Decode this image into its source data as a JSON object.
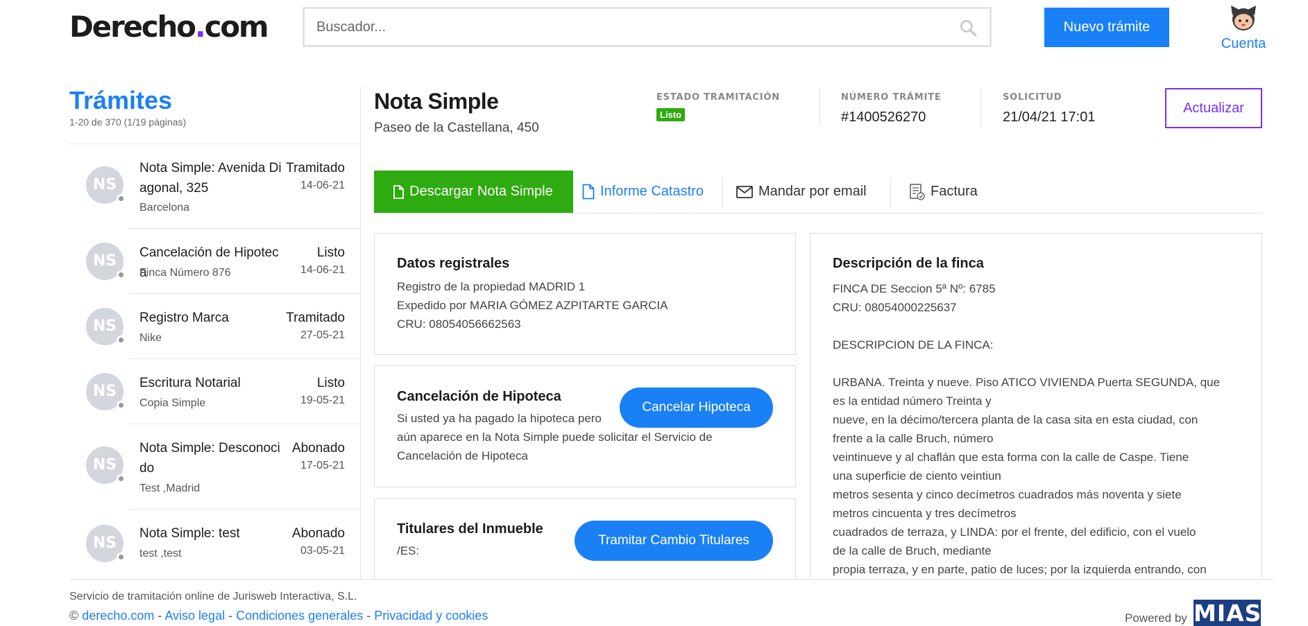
{
  "header": {
    "logo_main": "Derecho",
    "logo_dot": ".",
    "logo_tld": "com",
    "search_placeholder": "Buscador...",
    "new_button": "Nuevo trámite",
    "account_label": "Cuenta"
  },
  "sidebar": {
    "title": "Trámites",
    "subtitle": "1-20 de 370 (1/19 páginas)",
    "items": [
      {
        "initials": "NS",
        "title": "Nota Simple: Avenida Diagonal, 325",
        "subtitle": "Barcelona",
        "status": "Tramitado",
        "date": "14-06-21"
      },
      {
        "initials": "NS",
        "title": "Cancelación de Hipoteca",
        "subtitle": "Finca Número 876",
        "status": "Listo",
        "date": "14-06-21"
      },
      {
        "initials": "NS",
        "title": "Registro Marca",
        "subtitle": "Nike",
        "status": "Tramitado",
        "date": "27-05-21"
      },
      {
        "initials": "NS",
        "title": "Escritura Notarial",
        "subtitle": "Copia Simple",
        "status": "Listo",
        "date": "19-05-21"
      },
      {
        "initials": "NS",
        "title": "Nota Simple: Desconocido",
        "subtitle": "Test ,Madrid",
        "status": "Abonado",
        "date": "17-05-21"
      },
      {
        "initials": "NS",
        "title": "Nota Simple: test",
        "subtitle": "test ,test",
        "status": "Abonado",
        "date": "03-05-21"
      }
    ]
  },
  "detail": {
    "title": "Nota Simple",
    "address": "Paseo de la Castellana, 450",
    "estado_label": "ESTADO TRAMITACIÓN",
    "estado_value": "Listo",
    "numero_label": "NÚMERO TRÁMITE",
    "numero_value": "#1400526270",
    "solicitud_label": "SOLICITUD",
    "solicitud_value": "21/04/21 17:01",
    "update_button": "Actualizar"
  },
  "tabs": {
    "download": "Descargar Nota Simple",
    "catastro": "Informe Catastro",
    "email": "Mandar por email",
    "invoice": "Factura"
  },
  "registral": {
    "title": "Datos registrales",
    "line1": "Registro de la propiedad MADRID 1",
    "line2": "Expedido por MARIA GÓMEZ AZPITARTE GARCIA",
    "line3": "CRU: 08054056662563"
  },
  "hipoteca": {
    "title": "Cancelación de Hipoteca",
    "line1": "Si usted ya ha pagado la hipoteca pero",
    "line2": "aún aparece en la Nota Simple puede solicitar el Servicio de",
    "line3": "Cancelación de Hipoteca",
    "button": "Cancelar Hipoteca"
  },
  "titulares": {
    "title": "Titulares del Inmueble",
    "line1": "/ES:",
    "button": "Tramitar Cambio Titulares"
  },
  "descripcion": {
    "title": "Descripción de la finca",
    "lines": [
      "FINCA DE Seccion 5ª Nº: 6785",
      "CRU: 08054000225637",
      "",
      "DESCRIPCION DE LA FINCA:",
      "",
      "URBANA. Treinta y nueve. Piso ATICO VIVIENDA Puerta SEGUNDA, que",
      "es la entidad número Treinta y",
      "nueve, en la décimo/tercera planta de la casa sita en esta ciudad, con",
      "frente a la calle Bruch, número",
      "veintinueve y al chaflán que esta forma con la calle de Caspe. Tiene",
      "una superficie de ciento veintiun",
      "metros sesenta y cinco decímetros cuadrados más noventa y siete",
      "metros cincuenta y tres decímetros",
      "cuadrados de terraza, y LINDA: por el frente, del edificio, con el vuelo",
      "de la calle de Bruch, mediante",
      "propia terraza, y en parte, patio de luces; por la izquierda entrando, con"
    ]
  },
  "footer": {
    "company": "Servicio de tramitación online de Jurisweb Interactiva, S.L.",
    "copyright": "©",
    "link_site": "derecho.com",
    "sep": " - ",
    "link_legal": "Aviso legal",
    "link_terms": "Condiciones generales",
    "link_privacy": "Privacidad y cookies",
    "powered": "Powered by",
    "mias": "MIAS"
  },
  "colors": {
    "accent": "#1a80f5",
    "success": "#2eab10",
    "purple": "#7b2ff7",
    "brand_dark": "#1c3f83"
  }
}
